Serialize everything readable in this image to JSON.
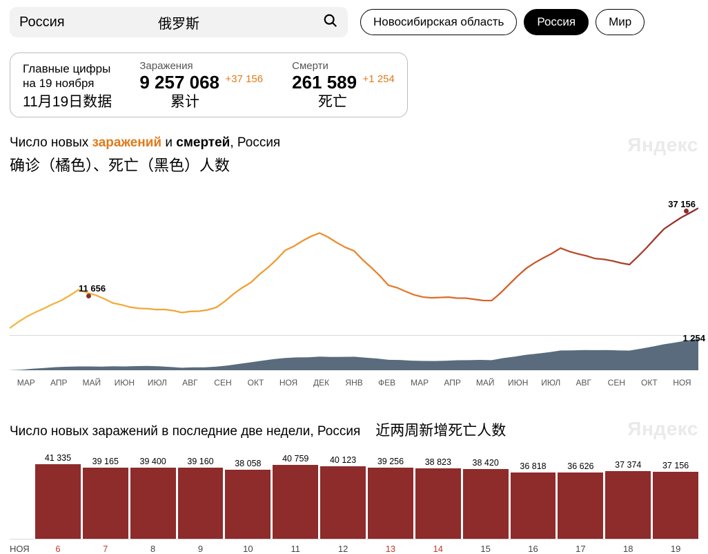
{
  "search": {
    "ru": "Россия",
    "zh": "俄罗斯"
  },
  "pills": {
    "region": "Новосибирская область",
    "country": "Россия",
    "world": "Мир"
  },
  "stats": {
    "headline1": "Главные цифры",
    "headline2": "на 19 ноября",
    "zh_date": "11月19日数据",
    "inf_label": "Заражения",
    "inf_value": "9 257 068",
    "inf_delta": "+37 156",
    "inf_zh": "累计",
    "death_label": "Смерти",
    "death_value": "261 589",
    "death_delta": "+1 254",
    "death_zh": "死亡"
  },
  "chart1": {
    "title_a": "Число новых ",
    "title_orange": "заражений",
    "title_mid": " и ",
    "title_black": "смертей",
    "title_end": ", Россия",
    "zh": "确诊（橘色）、死亡（黑色）人数",
    "watermark": "Яндекс",
    "callout_may": "11 656",
    "callout_now": "37 156",
    "deaths_now": "1 254",
    "months": [
      "МАР",
      "АПР",
      "МАЙ",
      "ИЮН",
      "ИЮЛ",
      "АВГ",
      "СЕН",
      "ОКТ",
      "НОЯ",
      "ДЕК",
      "ЯНВ",
      "ФЕВ",
      "МАР",
      "АПР",
      "МАЙ",
      "ИЮН",
      "ИЮЛ",
      "АВГ",
      "СЕН",
      "ОКТ",
      "НОЯ"
    ]
  },
  "chart2": {
    "title": "Число новых заражений в последние две недели, Россия",
    "zh": "近两周新增死亡人数",
    "watermark": "Яндекс",
    "xaxis_label": "НОЯ"
  },
  "chart_data": [
    {
      "type": "line",
      "title": "Число новых заражений и смертей, Россия",
      "series": [
        {
          "name": "Заражения",
          "color_start": "#f4b642",
          "color_end": "#8e2b2b",
          "months": [
            "МАР",
            "АПР",
            "МАЙ",
            "ИЮН",
            "ИЮЛ",
            "АВГ",
            "СЕН",
            "ОКТ",
            "НОЯ",
            "ДЕК",
            "ЯНВ",
            "ФЕВ",
            "МАР",
            "АПР",
            "МАЙ",
            "ИЮН",
            "ИЮЛ",
            "АВГ",
            "СЕН",
            "ОКТ",
            "НОЯ"
          ],
          "values": [
            200,
            6500,
            11656,
            8000,
            6000,
            5000,
            6500,
            14000,
            24000,
            29000,
            24000,
            13000,
            10000,
            9000,
            9000,
            18000,
            25000,
            21000,
            20000,
            30000,
            37156
          ]
        },
        {
          "name": "Смерти",
          "color": "#3b4a5a",
          "months": [
            "МАР",
            "АПР",
            "МАЙ",
            "ИЮН",
            "ИЮЛ",
            "АВГ",
            "СЕН",
            "ОКТ",
            "НОЯ",
            "ДЕК",
            "ЯНВ",
            "ФЕВ",
            "МАР",
            "АПР",
            "МАЙ",
            "ИЮН",
            "ИЮЛ",
            "АВГ",
            "СЕН",
            "ОКТ",
            "НОЯ"
          ],
          "values": [
            5,
            70,
            170,
            170,
            150,
            110,
            160,
            300,
            500,
            570,
            530,
            420,
            400,
            390,
            400,
            650,
            790,
            800,
            820,
            1050,
            1254
          ]
        }
      ],
      "ylim_infections": [
        0,
        40000
      ],
      "ylim_deaths": [
        0,
        1400
      ]
    },
    {
      "type": "bar",
      "title": "Число новых заражений в последние две недели, Россия",
      "categories": [
        "6",
        "7",
        "8",
        "9",
        "10",
        "11",
        "12",
        "13",
        "14",
        "15",
        "16",
        "17",
        "18",
        "19"
      ],
      "weekend_flags": [
        true,
        true,
        false,
        false,
        false,
        false,
        false,
        true,
        true,
        false,
        false,
        false,
        false,
        false
      ],
      "values": [
        41335,
        39165,
        39400,
        39160,
        38058,
        40759,
        40123,
        39256,
        38823,
        38420,
        36818,
        36626,
        37374,
        37156
      ],
      "ylim": [
        0,
        42000
      ],
      "month": "НОЯ",
      "color": "#8e2b2b"
    }
  ]
}
